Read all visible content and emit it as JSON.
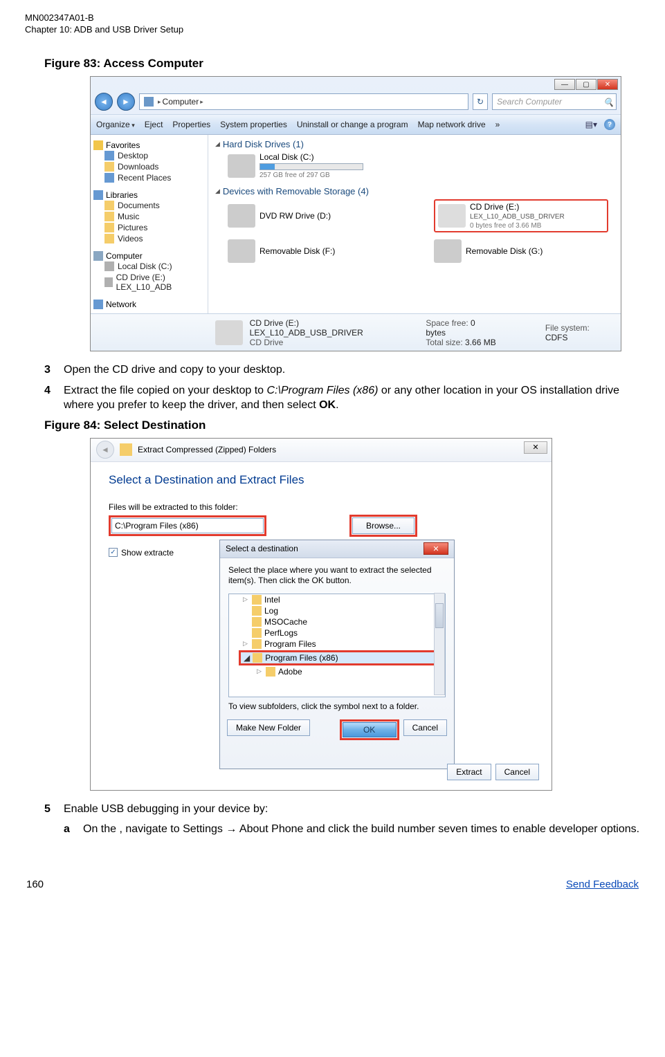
{
  "header": {
    "doc_id": "MN002347A01-B",
    "chapter_line": "Chapter 10:  ADB and USB Driver Setup"
  },
  "figures": {
    "fig1_label": "Figure 83: Access Computer",
    "fig2_label": "Figure 84: Select Destination"
  },
  "explorer": {
    "breadcrumb_root": "Computer",
    "breadcrumb_sep": "▸",
    "search_placeholder": "Search Computer",
    "toolbar": {
      "organize": "Organize",
      "eject": "Eject",
      "properties": "Properties",
      "sysprops": "System properties",
      "uninstall": "Uninstall or change a program",
      "mapdrive": "Map network drive",
      "more": "»"
    },
    "nav": {
      "favorites": "Favorites",
      "desktop": "Desktop",
      "downloads": "Downloads",
      "recent": "Recent Places",
      "libraries": "Libraries",
      "documents": "Documents",
      "music": "Music",
      "pictures": "Pictures",
      "videos": "Videos",
      "computer": "Computer",
      "localdisk": "Local Disk (C:)",
      "cddrive": "CD Drive (E:) LEX_L10_ADB",
      "network": "Network"
    },
    "content": {
      "hdd_section": "Hard Disk Drives (1)",
      "local_name": "Local Disk (C:)",
      "local_free": "257 GB free of 297 GB",
      "rem_section": "Devices with Removable Storage (4)",
      "dvd_name": "DVD RW Drive (D:)",
      "cd_name": "CD Drive (E:)",
      "cd_label": "LEX_L10_ADB_USB_DRIVER",
      "cd_free": "0 bytes free of 3.66 MB",
      "remf": "Removable Disk (F:)",
      "remg": "Removable Disk (G:)"
    },
    "details": {
      "name": "CD Drive (E:) LEX_L10_ADB_USB_DRIVER",
      "type": "CD Drive",
      "space_label": "Space free:",
      "space_val": "0 bytes",
      "total_label": "Total size:",
      "total_val": "3.66 MB",
      "fs_label": "File system:",
      "fs_val": "CDFS"
    }
  },
  "extract": {
    "title": "Extract Compressed (Zipped) Folders",
    "close_glyph": "✕",
    "heading": "Select a Destination and Extract Files",
    "files_label": "Files will be extracted to this folder:",
    "path_value": "C:\\Program Files (x86)",
    "browse_label": "Browse...",
    "show_label": "Show extracte",
    "sub": {
      "title": "Select a destination",
      "msg": "Select the place where you want to extract the selected item(s).  Then click the OK button.",
      "tree": {
        "intel": "Intel",
        "log": "Log",
        "msocache": "MSOCache",
        "perflogs": "PerfLogs",
        "progfiles": "Program Files",
        "progfiles86": "Program Files (x86)",
        "adobe": "Adobe"
      },
      "hint": "To view subfolders, click the symbol next to a folder.",
      "make_new": "Make New Folder",
      "ok": "OK",
      "cancel": "Cancel"
    },
    "extract_btn": "Extract",
    "cancel_btn": "Cancel"
  },
  "steps": {
    "s3": {
      "num": "3",
      "text": "Open the CD drive and copy to your desktop."
    },
    "s4": {
      "num": "4",
      "pre": "Extract the file copied on your desktop to ",
      "path": "C:\\Program Files (x86)",
      "mid": " or any other location in your OS installation drive where you prefer to keep the driver, and then select ",
      "ok": "OK",
      "post": "."
    },
    "s5": {
      "num": "5",
      "text": "Enable USB debugging in your device by:"
    },
    "s5a": {
      "num": "a",
      "pre": "On the , navigate to ",
      "settings": "Settings",
      "arrow": " → ",
      "about": "About Phone",
      "post": " and click the build number seven times to enable developer options."
    }
  },
  "footer": {
    "page": "160",
    "feedback": "Send Feedback"
  }
}
